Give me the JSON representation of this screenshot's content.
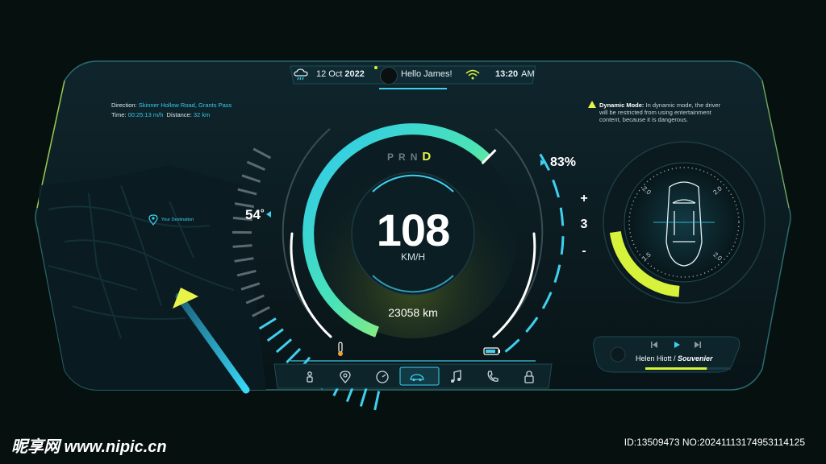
{
  "header": {
    "date_day": "12 Oct",
    "date_year": "2022",
    "greeting": "Hello James!",
    "time": "13:20",
    "meridiem": "AM"
  },
  "trip": {
    "direction_label": "Direction:",
    "direction_value": "Skinner Hollow Road, Grants Pass",
    "time_label": "Time:",
    "time_value": "00:25:13 m/h",
    "distance_label": "Distance:",
    "distance_value": "32 km"
  },
  "map": {
    "destination_label": "Your Destination"
  },
  "gauges": {
    "temperature": "54",
    "temperature_unit": "°",
    "battery_percent": "83%",
    "temperature_level": 0.45,
    "battery_level": 0.83
  },
  "speedometer": {
    "speed": "108",
    "unit": "KM/H",
    "odometer": "23058 km",
    "gears": [
      "P",
      "R",
      "N"
    ],
    "active_gear": "D",
    "speed_fraction": 0.62
  },
  "gear_control": {
    "plus_label": "+",
    "value": "3",
    "minus_label": "-"
  },
  "mode_notice": {
    "title": "Dynamic Mode:",
    "text_line1": "In dynamic mode, the driver",
    "text_line2": "will be restricted from using entertainment",
    "text_line3": "content, because it is dangerous."
  },
  "tires": {
    "front_left": "2.0",
    "front_right": "2.0",
    "rear_left": "1.5",
    "rear_right": "2.0"
  },
  "media": {
    "artist": "Helen Hiott",
    "separator": " / ",
    "track": "Souvenier",
    "progress": 0.72
  },
  "bottom_nav": [
    "gear-shift-icon",
    "location-pin-icon",
    "speedometer-icon",
    "car-icon",
    "music-note-icon",
    "phone-icon",
    "lock-icon"
  ],
  "colors": {
    "accent_cyan": "#3fd0f0",
    "accent_lime": "#d6f23a",
    "background": "#06100f",
    "panel": "#0d2228"
  },
  "watermark": {
    "left": "昵享网 www.nipic.cn",
    "right": "ID:13509473 NO:20241113174953114125"
  }
}
